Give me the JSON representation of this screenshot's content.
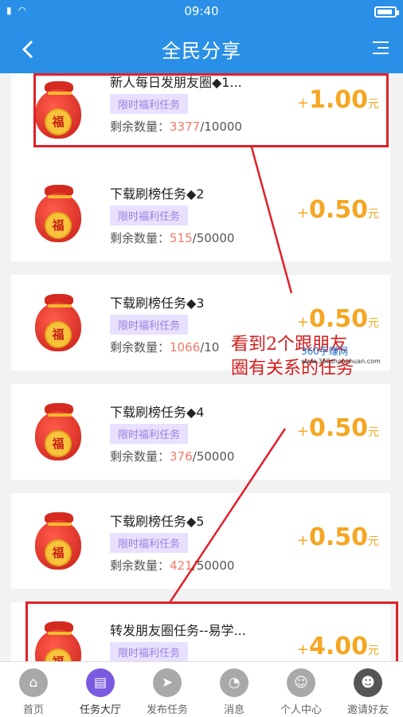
{
  "status": {
    "time": "09:40",
    "signal": "▮",
    "wifi": "◠"
  },
  "nav": {
    "title": "全民分享",
    "back_icon": "chevron-left-icon",
    "menu_icon": "menu-icon"
  },
  "tasks": [
    {
      "title": "新人每日发朋友圈◆1...",
      "tag": "限时福利任务",
      "remain_label": "剩余数量：",
      "remain_current": "3377",
      "remain_total": "/10000",
      "reward_plus": "+",
      "reward_amount": "1.00",
      "reward_unit": "元",
      "icon": "fortune-bag-icon",
      "icon_text": "福"
    },
    {
      "title": "下载刷榜任务◆2",
      "tag": "限时福利任务",
      "remain_label": "剩余数量：",
      "remain_current": "515",
      "remain_total": "/50000",
      "reward_plus": "+",
      "reward_amount": "0.50",
      "reward_unit": "元",
      "icon": "fortune-bag-icon",
      "icon_text": "福"
    },
    {
      "title": "下载刷榜任务◆3",
      "tag": "限时福利任务",
      "remain_label": "剩余数量：",
      "remain_current": "1066",
      "remain_total": "/10",
      "reward_plus": "+",
      "reward_amount": "0.50",
      "reward_unit": "元",
      "icon": "fortune-bag-icon",
      "icon_text": "福"
    },
    {
      "title": "下载刷榜任务◆4",
      "tag": "限时福利任务",
      "remain_label": "剩余数量：",
      "remain_current": "376",
      "remain_total": "/50000",
      "reward_plus": "+",
      "reward_amount": "0.50",
      "reward_unit": "元",
      "icon": "fortune-bag-icon",
      "icon_text": "福"
    },
    {
      "title": "下载刷榜任务◆5",
      "tag": "限时福利任务",
      "remain_label": "剩余数量：",
      "remain_current": "421",
      "remain_total": "/50000",
      "reward_plus": "+",
      "reward_amount": "0.50",
      "reward_unit": "元",
      "icon": "fortune-bag-icon",
      "icon_text": "福"
    },
    {
      "title": "转发朋友圈任务--易学...",
      "tag": "限时福利任务",
      "remain_label": "",
      "remain_current": "",
      "remain_total": "",
      "reward_plus": "+",
      "reward_amount": "4.00",
      "reward_unit": "元",
      "icon": "fortune-bag-icon",
      "icon_text": "福"
    }
  ],
  "annotation": {
    "line1": "看到2个跟朋友",
    "line2": "圈有关系的任务",
    "color": "#d51a1a"
  },
  "watermark": {
    "brand": "360手赚网",
    "url": "www.360shouzhuan.com"
  },
  "tabbar": [
    {
      "label": "首页",
      "icon": "home-icon",
      "glyph": "⌂",
      "active": false
    },
    {
      "label": "任务大厅",
      "icon": "task-hall-icon",
      "glyph": "▤",
      "active": true
    },
    {
      "label": "发布任务",
      "icon": "send-icon",
      "glyph": "➤",
      "active": false
    },
    {
      "label": "消息",
      "icon": "message-icon",
      "glyph": "◔",
      "active": false
    },
    {
      "label": "个人中心",
      "icon": "profile-icon",
      "glyph": "☺",
      "active": false
    },
    {
      "label": "邀请好友",
      "icon": "invite-icon",
      "glyph": "☻",
      "active": false
    }
  ],
  "colors": {
    "primary": "#2a8fe6",
    "accent": "#f5a623",
    "tab_active": "#7a5be0",
    "highlight": "#e0202a"
  }
}
